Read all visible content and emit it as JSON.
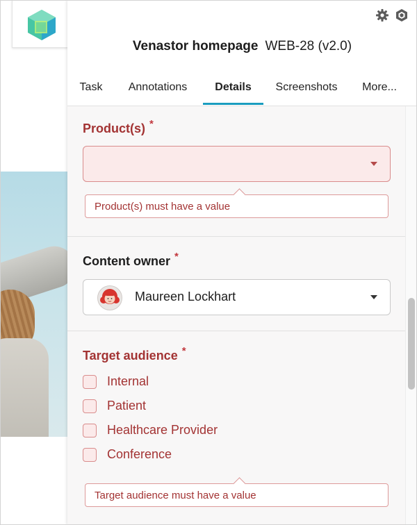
{
  "header": {
    "project_name": "Venastor homepage",
    "version": "WEB-28 (v2.0)"
  },
  "icons": {
    "settings": "gear-icon",
    "plugin": "cube-icon",
    "logo": "hexagon-logo-icon",
    "dropdown": "caret-down-icon"
  },
  "tabs": [
    {
      "label": "Task",
      "active": false
    },
    {
      "label": "Annotations",
      "active": false
    },
    {
      "label": "Details",
      "active": true
    },
    {
      "label": "Screenshots",
      "active": false
    },
    {
      "label": "More...",
      "active": false
    }
  ],
  "form": {
    "required_mark": "*",
    "products": {
      "label": "Product(s)",
      "value": "",
      "error": "Product(s) must have a value"
    },
    "content_owner": {
      "label": "Content owner",
      "value": "Maureen Lockhart"
    },
    "target_audience": {
      "label": "Target audience",
      "options": [
        {
          "label": "Internal",
          "checked": false
        },
        {
          "label": "Patient",
          "checked": false
        },
        {
          "label": "Healthcare Provider",
          "checked": false
        },
        {
          "label": "Conference",
          "checked": false
        }
      ],
      "error": "Target audience must have a value"
    }
  },
  "colors": {
    "accent": "#1a9dbf",
    "error_text": "#a33333",
    "error_bg": "#fbeaea",
    "required": "#c2383e"
  }
}
